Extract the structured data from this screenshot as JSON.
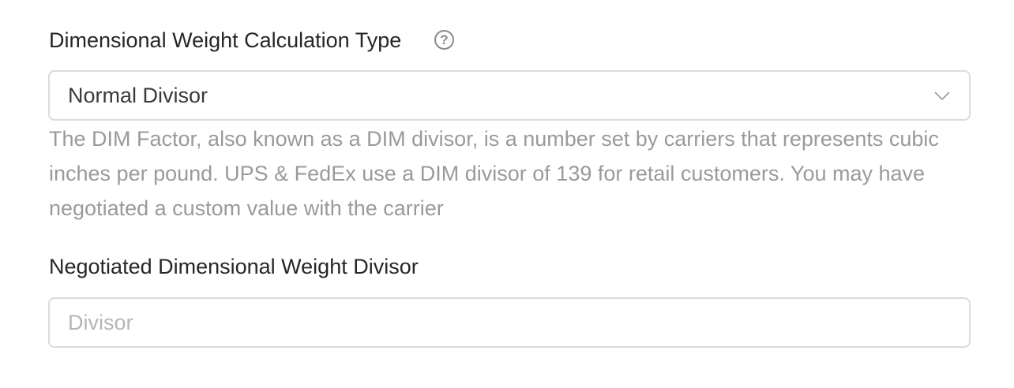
{
  "calculation_type": {
    "label": "Dimensional Weight Calculation Type",
    "help_icon": "question-circle-icon",
    "help_icon_glyph": "?",
    "selected_value": "Normal Divisor",
    "dropdown_icon": "chevron-down-icon",
    "description": "The DIM Factor, also known as a DIM divisor, is a number set by carriers that represents cubic inches per pound. UPS & FedEx use a DIM divisor of 139 for retail customers. You may have negotiated a custom value with the carrier"
  },
  "negotiated_divisor": {
    "label": "Negotiated Dimensional Weight Divisor",
    "value": "",
    "placeholder": "Divisor"
  },
  "colors": {
    "label_text": "#262626",
    "help_text": "#9a9a9a",
    "border": "#dcdcdc",
    "placeholder": "#b6b6b6",
    "icon": "#8a8a8a"
  }
}
